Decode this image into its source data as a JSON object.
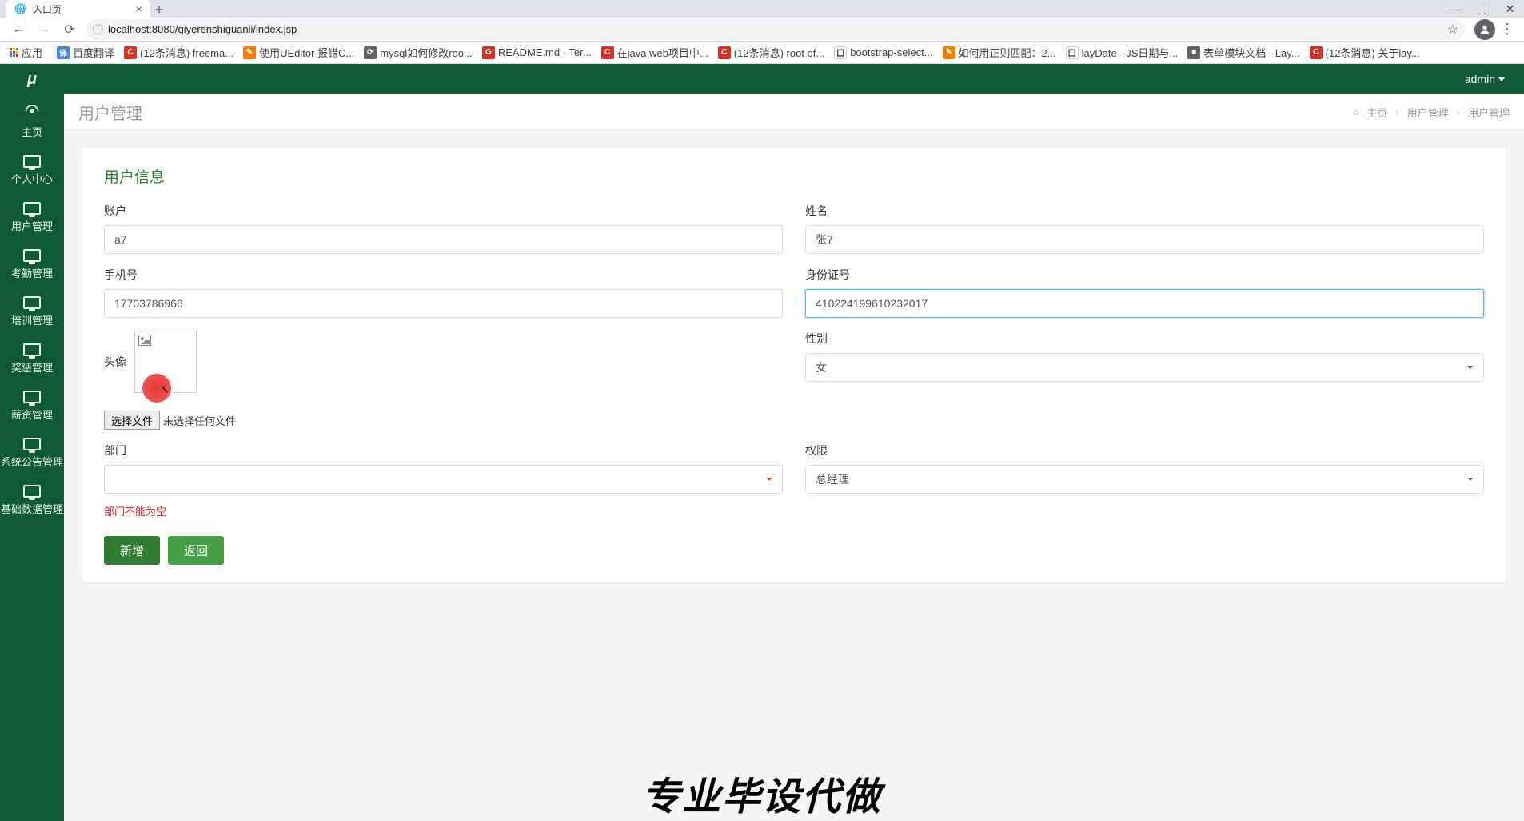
{
  "browser": {
    "tab_title": "入口页",
    "url_info_icon": "ⓘ",
    "url": "localhost:8080/qiyerenshiguanli/index.jsp",
    "bookmarks_apps": "应用",
    "bookmarks": [
      {
        "label": "百度翻译",
        "color": "ico-blue",
        "ic": "译"
      },
      {
        "label": "(12条消息) freema...",
        "color": "ico-red",
        "ic": "C"
      },
      {
        "label": "使用UEditor 报错C...",
        "color": "ico-orange",
        "ic": "✎"
      },
      {
        "label": "mysql如何修改roo...",
        "color": "ico-grey",
        "ic": "⟳"
      },
      {
        "label": "README.md · Ter...",
        "color": "ico-red",
        "ic": "G"
      },
      {
        "label": "在java web项目中...",
        "color": "ico-red",
        "ic": "C"
      },
      {
        "label": "(12条消息) root of...",
        "color": "ico-red",
        "ic": "C"
      },
      {
        "label": "bootstrap-select...",
        "color": "ico-white",
        "ic": "囗"
      },
      {
        "label": "如何用正则匹配：2...",
        "color": "ico-orange",
        "ic": "✎"
      },
      {
        "label": "layDate - JS日期与...",
        "color": "ico-white",
        "ic": "囗"
      },
      {
        "label": "表单模块文档 - Lay...",
        "color": "ico-grey",
        "ic": "■"
      },
      {
        "label": "(12条消息) 关于lay...",
        "color": "ico-red",
        "ic": "C"
      }
    ]
  },
  "header": {
    "username": "admin"
  },
  "sidebar": {
    "logo": "μ",
    "items": [
      {
        "label": "主页",
        "icon": "dashboard"
      },
      {
        "label": "个人中心",
        "icon": "monitor"
      },
      {
        "label": "用户管理",
        "icon": "monitor"
      },
      {
        "label": "考勤管理",
        "icon": "monitor"
      },
      {
        "label": "培训管理",
        "icon": "monitor"
      },
      {
        "label": "奖惩管理",
        "icon": "monitor"
      },
      {
        "label": "薪资管理",
        "icon": "monitor"
      },
      {
        "label": "系统公告管理",
        "icon": "monitor"
      },
      {
        "label": "基础数据管理",
        "icon": "monitor"
      }
    ]
  },
  "page": {
    "title": "用户管理",
    "breadcrumb": {
      "home": "主页",
      "mid": "用户管理",
      "last": "用户管理"
    }
  },
  "form": {
    "section_title": "用户信息",
    "fields": {
      "account": {
        "label": "账户",
        "value": "a7"
      },
      "name": {
        "label": "姓名",
        "value": "张7"
      },
      "phone": {
        "label": "手机号",
        "value": "17703786966"
      },
      "idcard": {
        "label": "身份证号",
        "value": "410224199610232017"
      },
      "avatar": {
        "label": "头像",
        "choose_button": "选择文件",
        "no_file": "未选择任何文件"
      },
      "gender": {
        "label": "性别",
        "value": "女"
      },
      "dept": {
        "label": "部门",
        "value": "",
        "error": "部门不能为空"
      },
      "role": {
        "label": "权限",
        "value": "总经理"
      }
    },
    "buttons": {
      "submit": "新增",
      "back": "返回"
    }
  },
  "watermark": "专业毕设代做"
}
